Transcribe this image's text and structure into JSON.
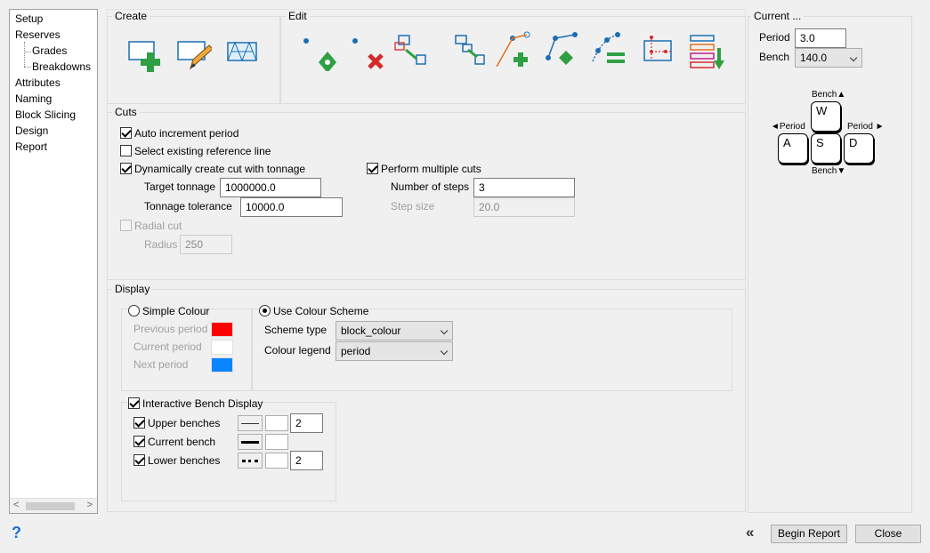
{
  "sidebar": {
    "items": [
      {
        "label": "Setup"
      },
      {
        "label": "Reserves"
      },
      {
        "label": "Grades"
      },
      {
        "label": "Breakdowns"
      },
      {
        "label": "Attributes"
      },
      {
        "label": "Naming"
      },
      {
        "label": "Block Slicing"
      },
      {
        "label": "Design"
      },
      {
        "label": "Report"
      }
    ]
  },
  "create": {
    "title": "Create"
  },
  "edit": {
    "title": "Edit"
  },
  "current": {
    "title": "Current ...",
    "period_label": "Period",
    "period_value": "3.0",
    "bench_label": "Bench",
    "bench_value": "140.0",
    "keys": {
      "w": "W",
      "a": "A",
      "s": "S",
      "d": "D",
      "bench_up": "Bench▲",
      "bench_down": "Bench▼",
      "period_left": "◄Period",
      "period_right": "Period ►"
    }
  },
  "cuts": {
    "title": "Cuts",
    "auto_increment": "Auto increment period",
    "select_existing": "Select existing reference line",
    "dynamic_cut": "Dynamically create cut with tonnage",
    "target_tonnage_label": "Target tonnage",
    "target_tonnage": "1000000.0",
    "tonnage_tolerance_label": "Tonnage tolerance",
    "tonnage_tolerance": "10000.0",
    "multiple_cuts": "Perform multiple cuts",
    "steps_label": "Number of steps",
    "steps": "3",
    "step_size_label": "Step size",
    "step_size": "20.0",
    "radial_cut": "Radial cut",
    "radius_label": "Radius",
    "radius": "250"
  },
  "display": {
    "title": "Display",
    "simple_colour": "Simple Colour",
    "previous_period": "Previous period",
    "current_period": "Current period",
    "next_period": "Next period",
    "use_scheme": "Use Colour Scheme",
    "scheme_type_label": "Scheme type",
    "scheme_type": "block_colour",
    "colour_legend_label": "Colour legend",
    "colour_legend": "period",
    "bench_display": "Interactive Bench Display",
    "upper_benches": "Upper benches",
    "upper_value": "2",
    "current_bench": "Current bench",
    "lower_benches": "Lower benches",
    "lower_value": "2",
    "colors": {
      "previous": "#ff0000",
      "current": "#ffffff",
      "next": "#0a84ff"
    }
  },
  "footer": {
    "help": "?",
    "collapse": "«",
    "begin_report": "Begin Report",
    "close": "Close"
  }
}
